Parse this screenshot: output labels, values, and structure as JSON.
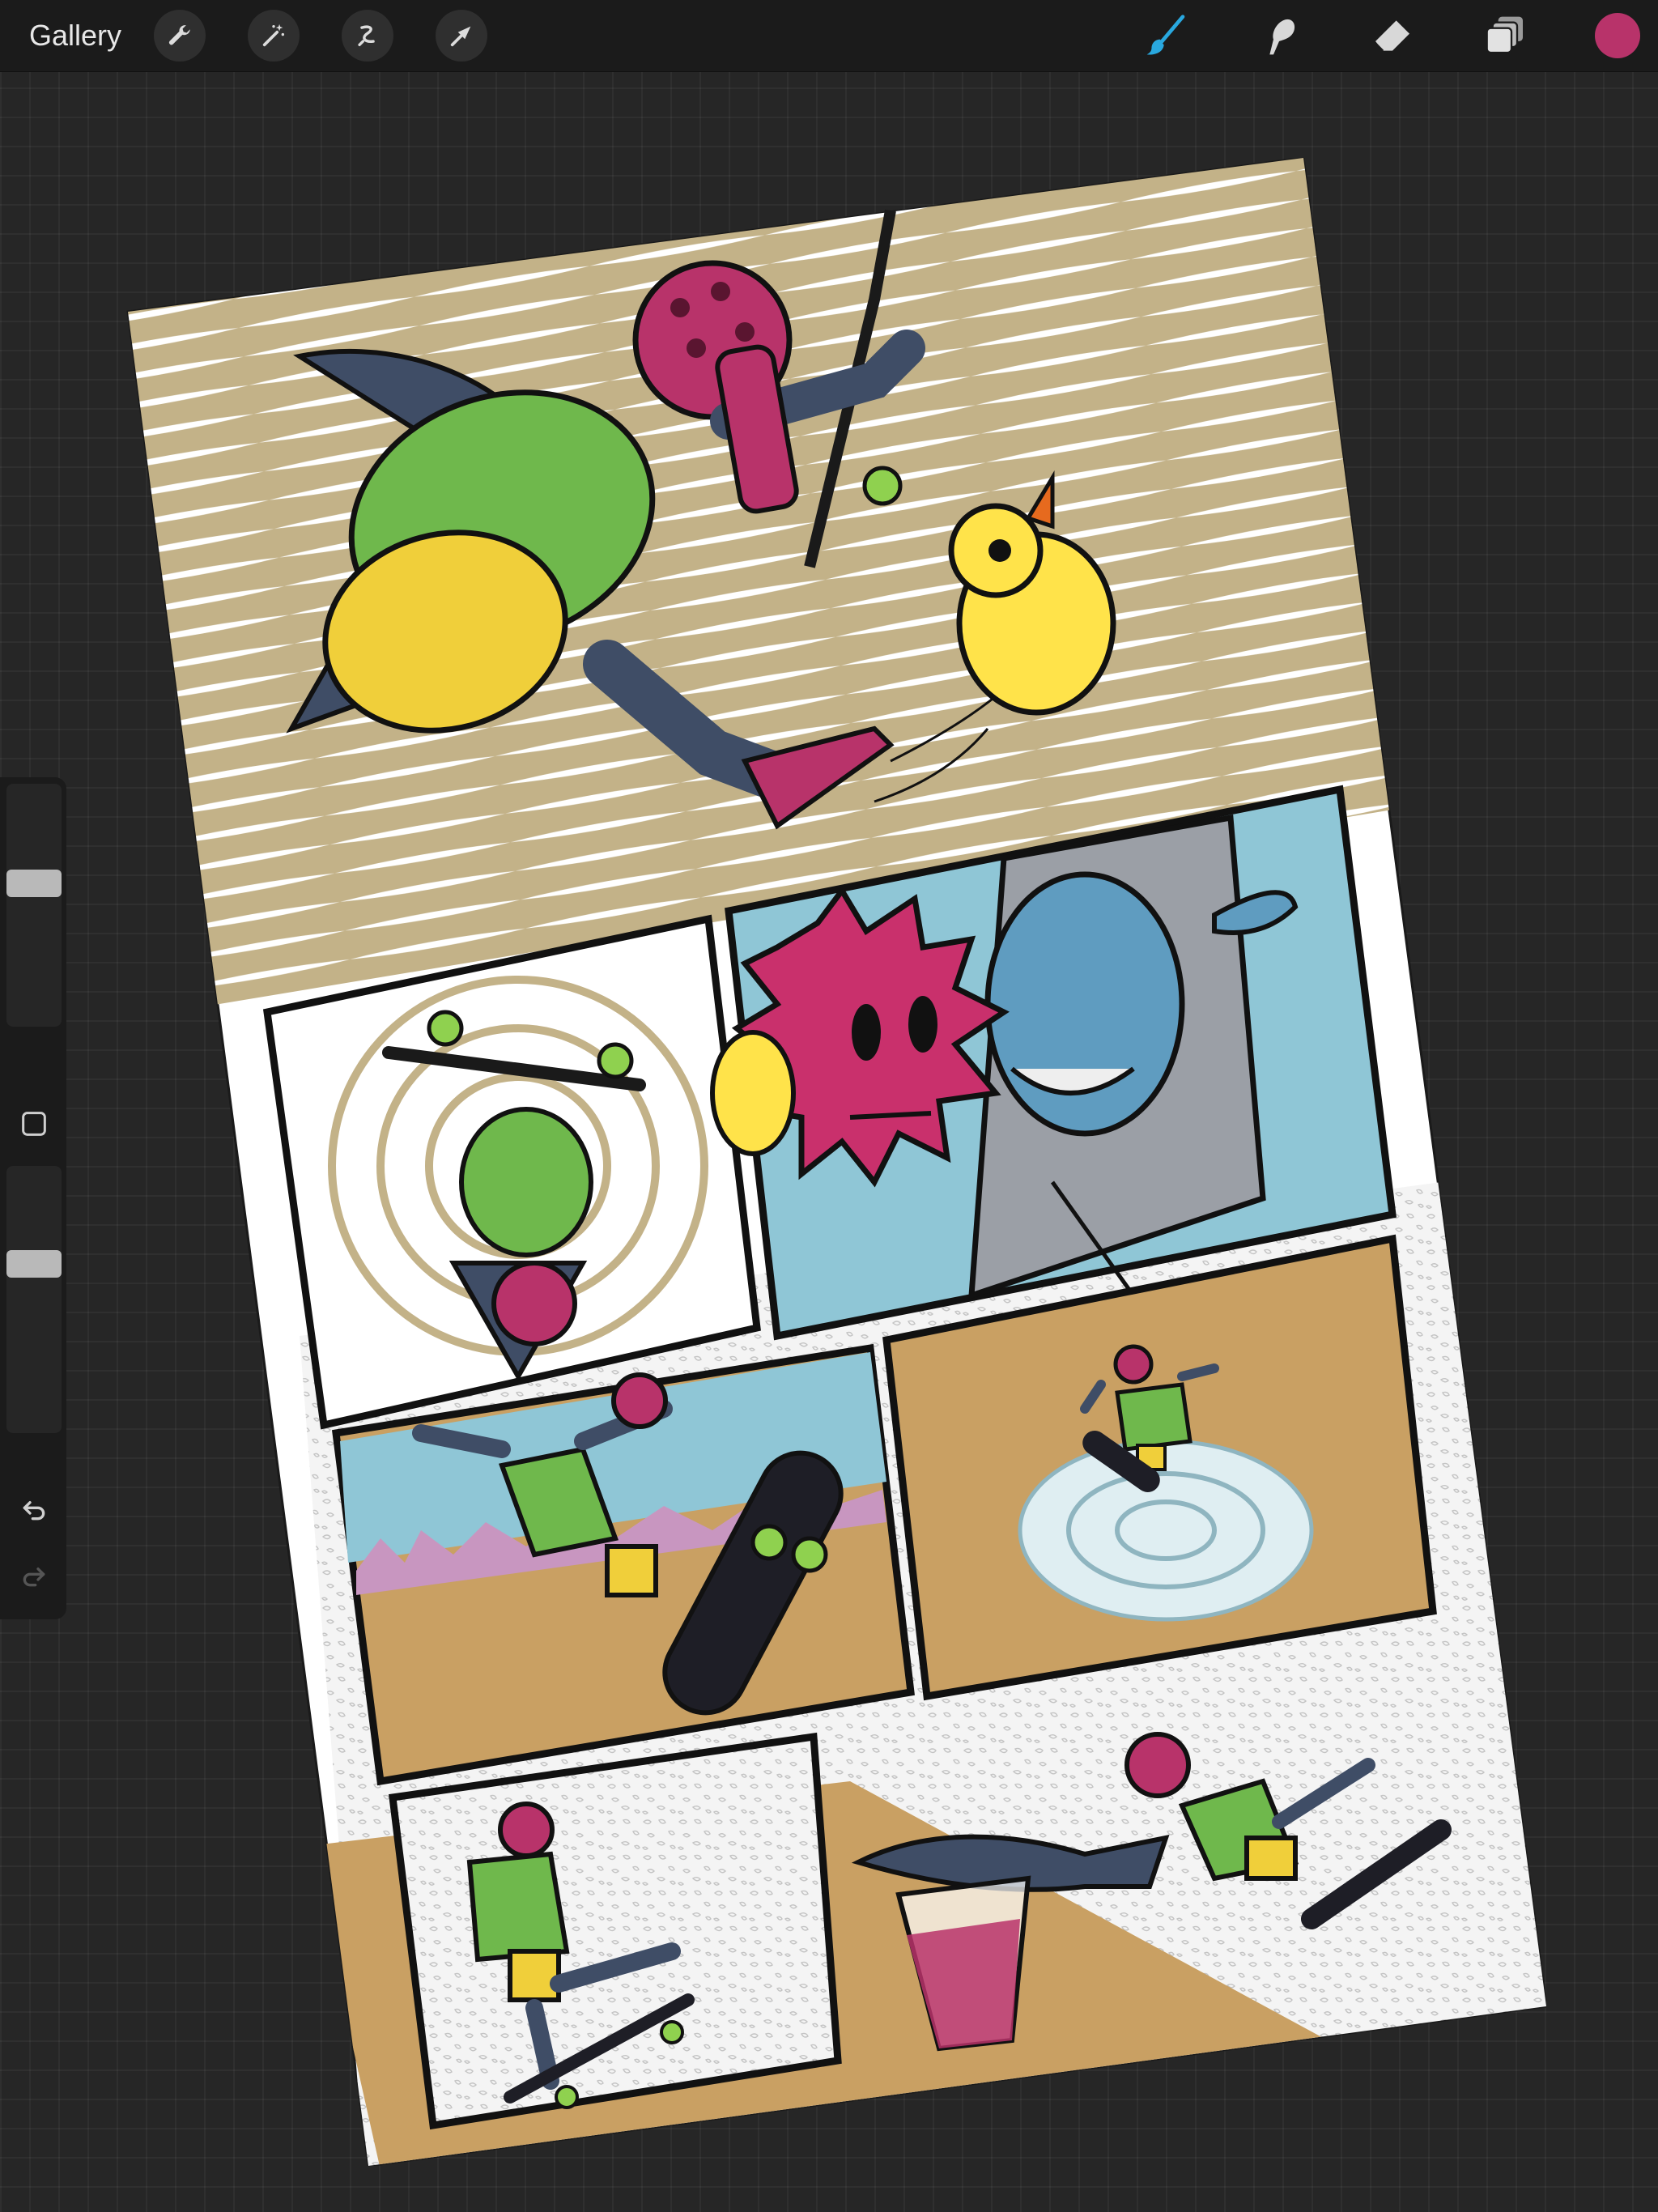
{
  "toolbar": {
    "gallery_label": "Gallery",
    "left_tools": [
      "wrench-icon",
      "magic-wand-icon",
      "selection-icon",
      "transform-arrow-icon"
    ],
    "right_tools": [
      "brush-icon",
      "smudge-icon",
      "eraser-icon",
      "layers-icon"
    ],
    "active_tool": "brush-icon",
    "current_color": "#b8336a"
  },
  "sidebar": {
    "brush_size_level": 0.4,
    "opacity_level": 0.35,
    "buttons": [
      "modify-square-icon",
      "undo-icon",
      "redo-icon"
    ]
  },
  "colors": {
    "accent": "#b8336a",
    "brush_active": "#29a8df",
    "tan": "#c9a063",
    "shark_blue": "#3f4d66",
    "shirt_green": "#6fb84c",
    "shorts_yellow": "#f0cf3a",
    "duck_yellow": "#ffe34a",
    "sky": "#8fc6d6"
  }
}
